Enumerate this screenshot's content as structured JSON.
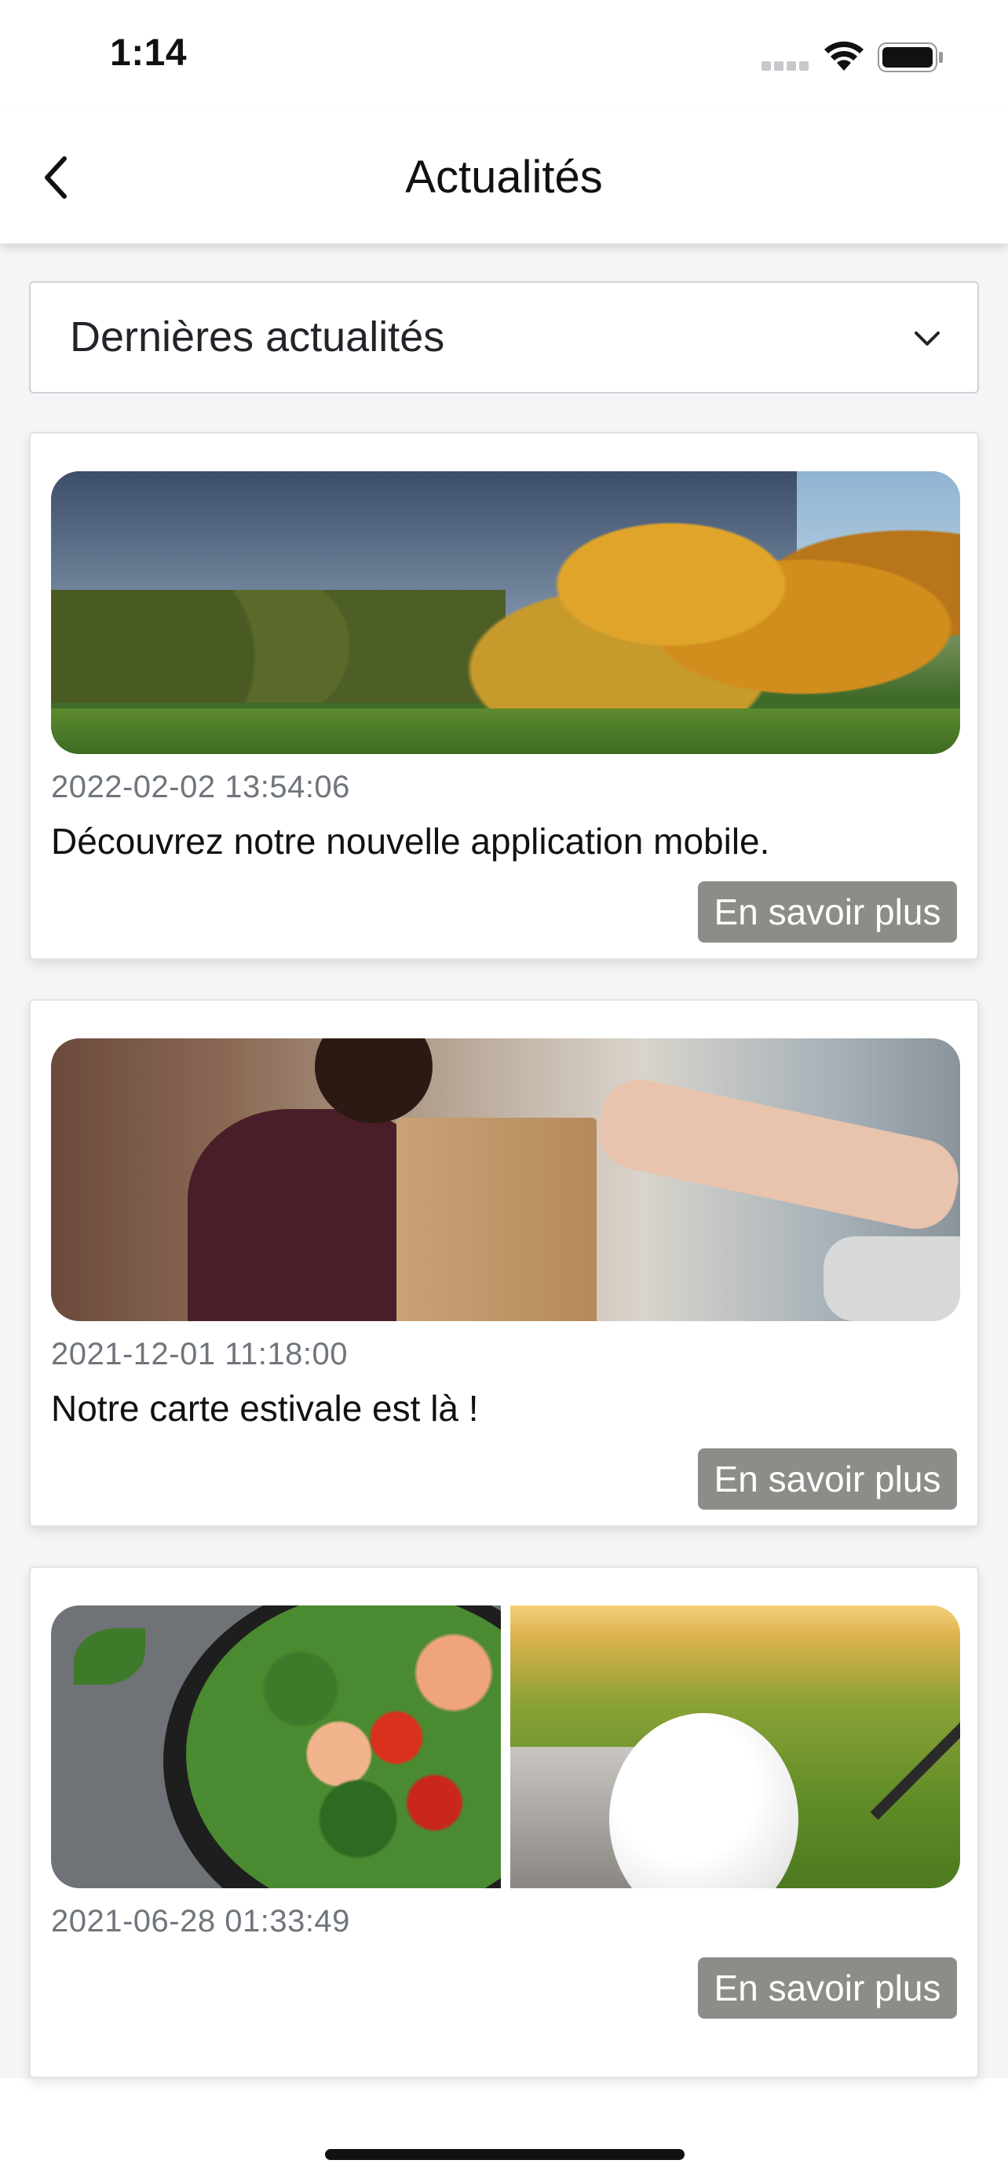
{
  "status_bar": {
    "time": "1:14"
  },
  "nav": {
    "title": "Actualités",
    "back_icon": "chevron-left-icon"
  },
  "filter": {
    "selected": "Dernières actualités",
    "icon": "chevron-down-icon"
  },
  "articles": [
    {
      "date": "2022-02-02 13:54:06",
      "title": "Découvrez notre nouvelle application mobile.",
      "button": "En savoir plus"
    },
    {
      "date": "2021-12-01 11:18:00",
      "title": "Notre carte estivale est là !",
      "button": "En savoir plus"
    },
    {
      "date": "2021-06-28 01:33:49",
      "title": "",
      "button": "En savoir plus"
    }
  ],
  "colors": {
    "button_bg": "#8c8c88",
    "date_text": "#6f757c",
    "page_bg": "#f4f5f6"
  }
}
